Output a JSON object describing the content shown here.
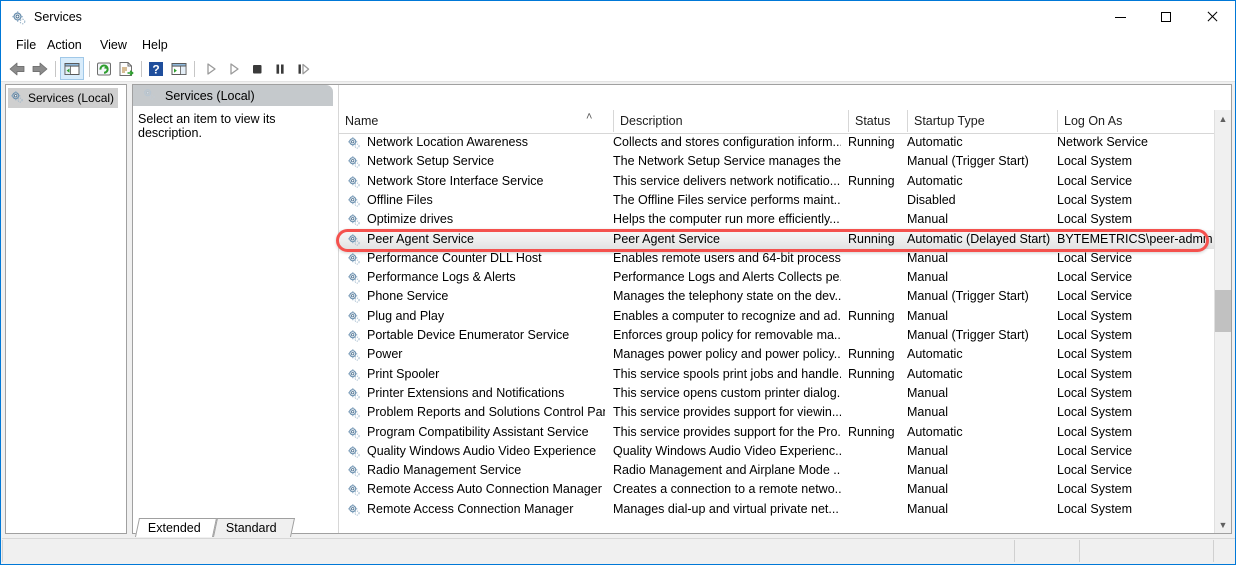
{
  "window": {
    "title": "Services",
    "icon": "services-gear-icon",
    "controls": {
      "minimize": "—",
      "maximize": "□",
      "close": "✕"
    }
  },
  "menubar": {
    "items": [
      "File",
      "Action",
      "View",
      "Help"
    ]
  },
  "toolbar": {
    "buttons": [
      "back-arrow-icon",
      "forward-arrow-icon",
      "show-hide-console-tree-icon",
      "refresh-icon",
      "export-list-icon",
      "help-icon",
      "show-hide-action-pane-icon",
      "start-service-icon",
      "restart-service-icon",
      "stop-service-icon",
      "pause-service-icon",
      "resume-service-icon"
    ]
  },
  "left_pane": {
    "tree_root": "Services (Local)"
  },
  "right_pane": {
    "header_title": "Services (Local)",
    "description_prompt": "Select an item to view its description."
  },
  "list": {
    "columns": [
      {
        "label": "Name"
      },
      {
        "label": "Description"
      },
      {
        "label": "Status"
      },
      {
        "label": "Startup Type"
      },
      {
        "label": "Log On As"
      }
    ],
    "sort_indicator": "˄",
    "rows": [
      {
        "name": "Network Location Awareness",
        "description": "Collects and stores configuration inform...",
        "status": "Running",
        "startup": "Automatic",
        "logon": "Network Service",
        "highlighted": false
      },
      {
        "name": "Network Setup Service",
        "description": "The Network Setup Service manages the...",
        "status": "",
        "startup": "Manual (Trigger Start)",
        "logon": "Local System",
        "highlighted": false
      },
      {
        "name": "Network Store Interface Service",
        "description": "This service delivers network notificatio...",
        "status": "Running",
        "startup": "Automatic",
        "logon": "Local Service",
        "highlighted": false
      },
      {
        "name": "Offline Files",
        "description": "The Offline Files service performs maint...",
        "status": "",
        "startup": "Disabled",
        "logon": "Local System",
        "highlighted": false
      },
      {
        "name": "Optimize drives",
        "description": "Helps the computer run more efficiently...",
        "status": "",
        "startup": "Manual",
        "logon": "Local System",
        "highlighted": false
      },
      {
        "name": "Peer Agent Service",
        "description": "Peer Agent Service",
        "status": "Running",
        "startup": "Automatic (Delayed Start)",
        "logon": "BYTEMETRICS\\peer-admin",
        "highlighted": true
      },
      {
        "name": "Performance Counter DLL Host",
        "description": "Enables remote users and 64-bit process...",
        "status": "",
        "startup": "Manual",
        "logon": "Local Service",
        "highlighted": false
      },
      {
        "name": "Performance Logs & Alerts",
        "description": "Performance Logs and Alerts Collects pe...",
        "status": "",
        "startup": "Manual",
        "logon": "Local Service",
        "highlighted": false
      },
      {
        "name": "Phone Service",
        "description": "Manages the telephony state on the dev...",
        "status": "",
        "startup": "Manual (Trigger Start)",
        "logon": "Local Service",
        "highlighted": false
      },
      {
        "name": "Plug and Play",
        "description": "Enables a computer to recognize and ad...",
        "status": "Running",
        "startup": "Manual",
        "logon": "Local System",
        "highlighted": false
      },
      {
        "name": "Portable Device Enumerator Service",
        "description": "Enforces group policy for removable ma...",
        "status": "",
        "startup": "Manual (Trigger Start)",
        "logon": "Local System",
        "highlighted": false
      },
      {
        "name": "Power",
        "description": "Manages power policy and power policy...",
        "status": "Running",
        "startup": "Automatic",
        "logon": "Local System",
        "highlighted": false
      },
      {
        "name": "Print Spooler",
        "description": "This service spools print jobs and handle...",
        "status": "Running",
        "startup": "Automatic",
        "logon": "Local System",
        "highlighted": false
      },
      {
        "name": "Printer Extensions and Notifications",
        "description": "This service opens custom printer dialog...",
        "status": "",
        "startup": "Manual",
        "logon": "Local System",
        "highlighted": false
      },
      {
        "name": "Problem Reports and Solutions Control Pan...",
        "description": "This service provides support for viewin...",
        "status": "",
        "startup": "Manual",
        "logon": "Local System",
        "highlighted": false
      },
      {
        "name": "Program Compatibility Assistant Service",
        "description": "This service provides support for the Pro...",
        "status": "Running",
        "startup": "Automatic",
        "logon": "Local System",
        "highlighted": false
      },
      {
        "name": "Quality Windows Audio Video Experience",
        "description": "Quality Windows Audio Video Experienc...",
        "status": "",
        "startup": "Manual",
        "logon": "Local Service",
        "highlighted": false
      },
      {
        "name": "Radio Management Service",
        "description": "Radio Management and Airplane Mode ...",
        "status": "",
        "startup": "Manual",
        "logon": "Local Service",
        "highlighted": false
      },
      {
        "name": "Remote Access Auto Connection Manager",
        "description": "Creates a connection to a remote netwo...",
        "status": "",
        "startup": "Manual",
        "logon": "Local System",
        "highlighted": false
      },
      {
        "name": "Remote Access Connection Manager",
        "description": "Manages dial-up and virtual private net...",
        "status": "",
        "startup": "Manual",
        "logon": "Local System",
        "highlighted": false
      }
    ]
  },
  "tabs": [
    {
      "label": "Extended",
      "active": true
    },
    {
      "label": "Standard",
      "active": false
    }
  ],
  "annotation": {
    "color": "#f4514d",
    "target_row": "Peer Agent Service"
  },
  "statusbar": {
    "segments": [
      "",
      "",
      "",
      ""
    ]
  }
}
